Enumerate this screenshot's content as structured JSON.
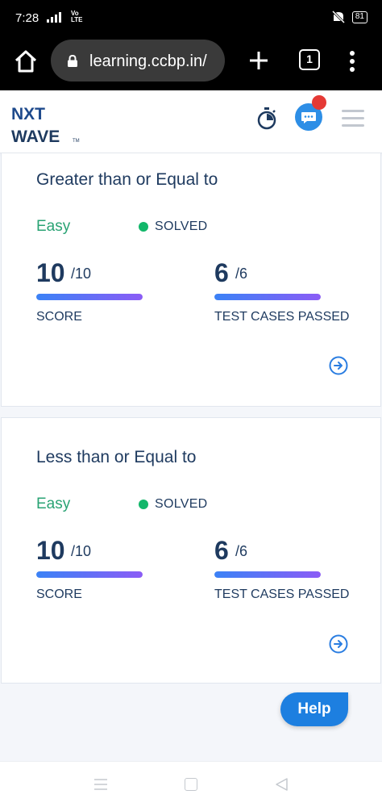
{
  "status_bar": {
    "time": "7:28",
    "network": "4G",
    "volte": "Vo LTE",
    "battery": "81"
  },
  "browser": {
    "url": "learning.ccbp.in/",
    "tab_count": "1"
  },
  "app": {
    "logo_top": "NXT",
    "logo_bottom": "WAVE",
    "logo_tm": "TM"
  },
  "questions": [
    {
      "title": "Greater than or Equal to",
      "difficulty": "Easy",
      "status": "SOLVED",
      "score": {
        "value": "10",
        "total": "/10",
        "label": "SCORE",
        "fraction": 1.0
      },
      "tests": {
        "value": "6",
        "total": "/6",
        "label": "TEST CASES PASSED",
        "fraction": 1.0
      }
    },
    {
      "title": "Less than or Equal to",
      "difficulty": "Easy",
      "status": "SOLVED",
      "score": {
        "value": "10",
        "total": "/10",
        "label": "SCORE",
        "fraction": 1.0
      },
      "tests": {
        "value": "6",
        "total": "/6",
        "label": "TEST CASES PASSED",
        "fraction": 1.0
      }
    }
  ],
  "help": {
    "label": "Help"
  },
  "colors": {
    "accent": "#1d7fe0",
    "solved": "#12b76a",
    "easy": "#2aa374",
    "title": "#1e3a5f",
    "notification": "#e53935"
  },
  "icons": [
    "home-icon",
    "lock-icon",
    "plus-icon",
    "tabs-icon",
    "more-vert-icon",
    "timer-icon",
    "chat-icon",
    "hamburger-icon",
    "arrow-right-circle-icon"
  ]
}
